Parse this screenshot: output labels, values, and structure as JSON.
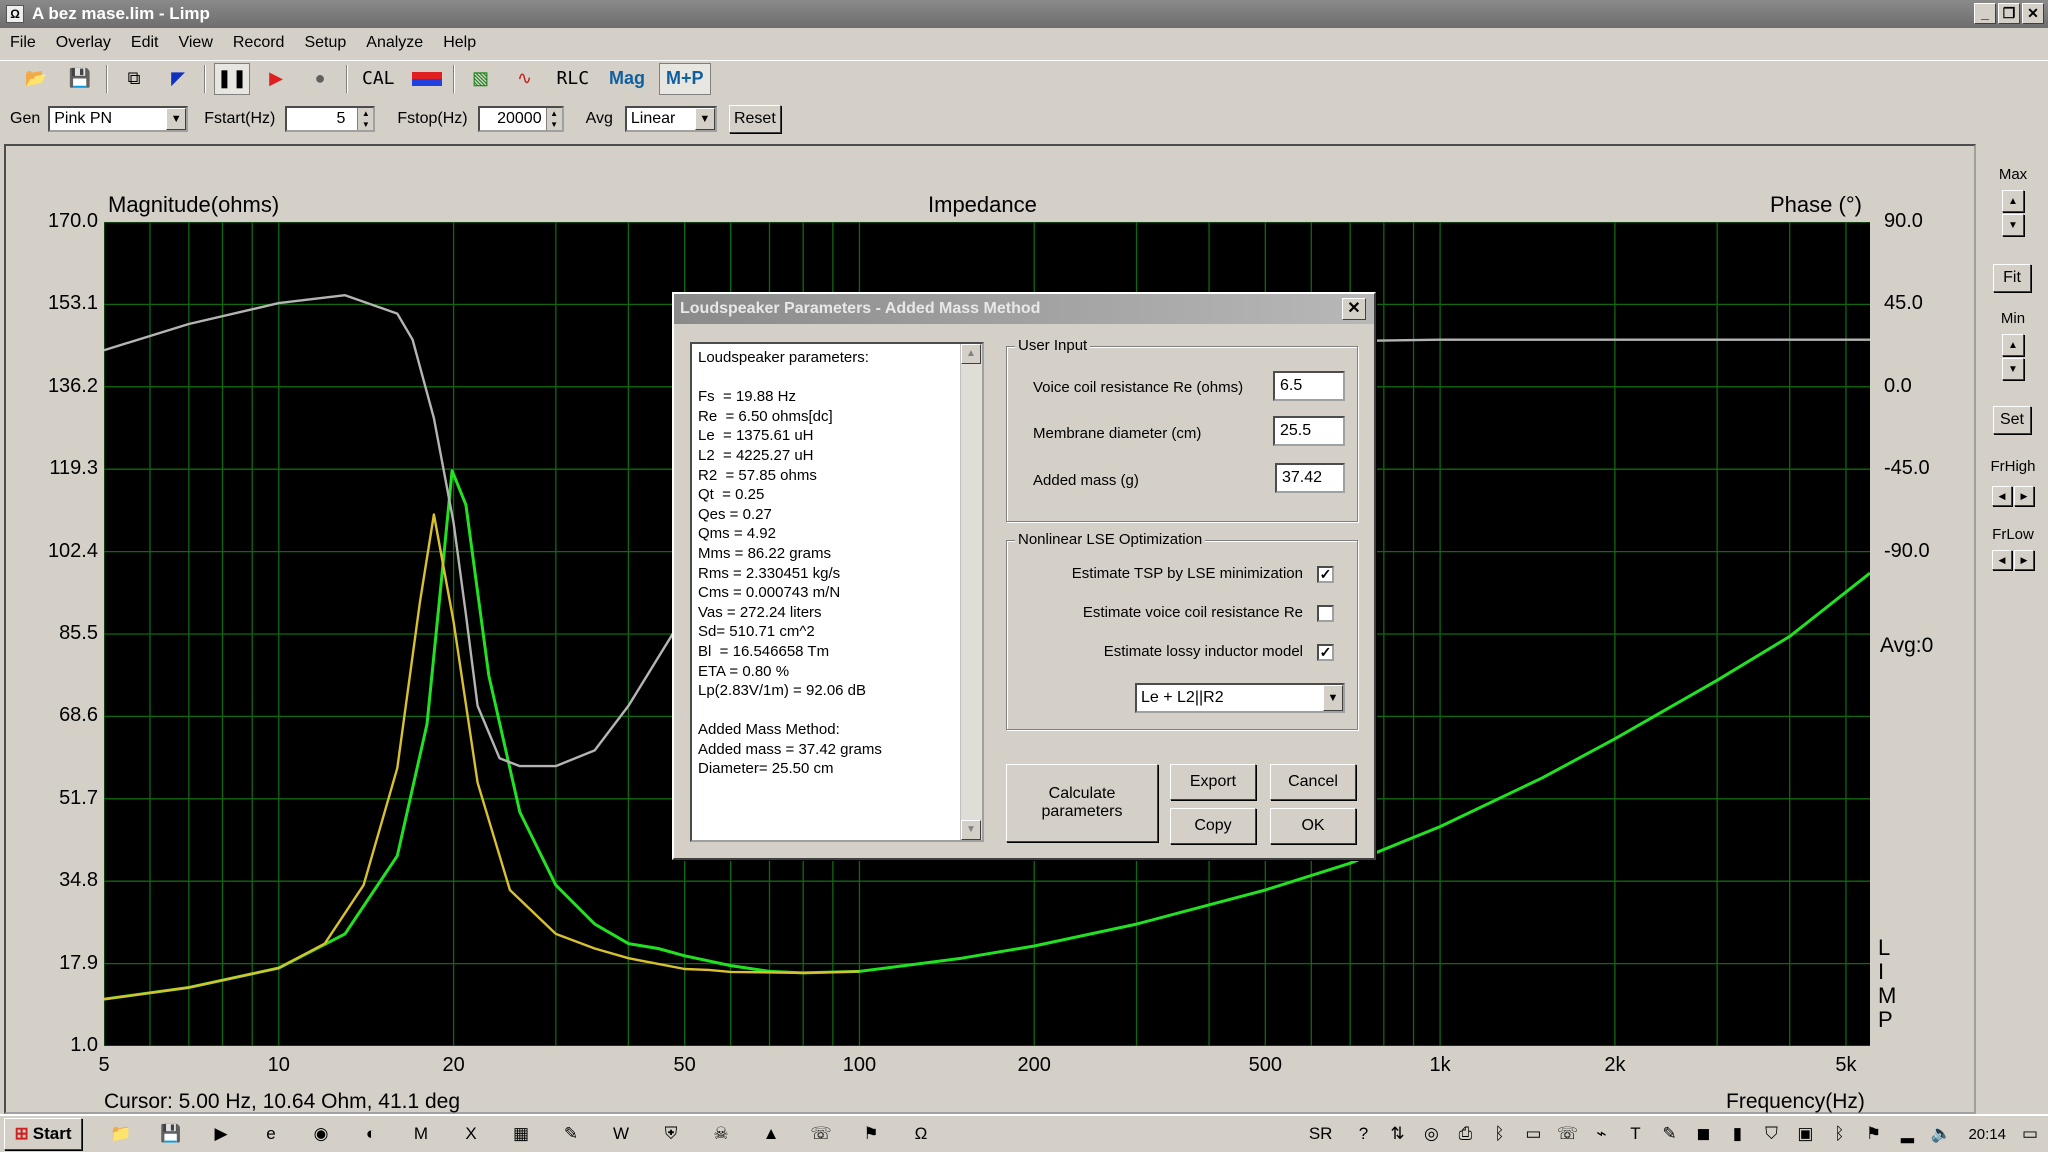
{
  "window": {
    "title": "A bez mase.lim - Limp",
    "app_icon": "window-icon"
  },
  "menu": [
    "File",
    "Overlay",
    "Edit",
    "View",
    "Record",
    "Setup",
    "Analyze",
    "Help"
  ],
  "toolbar": {
    "cal_label": "CAL",
    "rlc_label": "RLC",
    "mag_label": "Mag",
    "mp_label": "M+P",
    "icons": [
      "open-folder-icon",
      "save-disk-icon",
      "copy-icon",
      "pen-icon",
      "pause-icon",
      "play-icon",
      "stop-icon",
      "cal-icon",
      "color-bar-icon",
      "waveform-icon",
      "curve-icon",
      "rlc-icon",
      "mag-icon",
      "mp-icon"
    ]
  },
  "gen": {
    "gen_label": "Gen",
    "gen_value": "Pink PN",
    "fstart_label": "Fstart(Hz)",
    "fstart_value": "5",
    "fstop_label": "Fstop(Hz)",
    "fstop_value": "20000",
    "avg_label": "Avg",
    "avg_value": "Linear",
    "reset_label": "Reset"
  },
  "plot": {
    "title": "Impedance",
    "left_axis_title": "Magnitude(ohms)",
    "right_axis_title": "Phase (°)",
    "freq_label": "Frequency(Hz)",
    "avg_label": "Avg:0",
    "cursor": "Cursor: 5.00 Hz, 10.64 Ohm, 41.1 deg",
    "vertical_text": [
      "L",
      "I",
      "M",
      "P"
    ],
    "y_ticks": [
      "170.0",
      "153.1",
      "136.2",
      "119.3",
      "102.4",
      "85.5",
      "68.6",
      "51.7",
      "34.8",
      "17.9",
      "1.0"
    ],
    "phase_ticks": [
      "90.0",
      "45.0",
      "0.0",
      "-45.0",
      "-90.0"
    ],
    "x_ticks": [
      "5",
      "10",
      "20",
      "50",
      "100",
      "200",
      "500",
      "1k",
      "2k",
      "5k"
    ]
  },
  "chart_data": {
    "type": "line",
    "title": "Impedance",
    "xlabel": "Frequency(Hz)",
    "ylabel": "Magnitude(ohms)",
    "y2label": "Phase (°)",
    "xscale": "log",
    "xlim": [
      5,
      5500
    ],
    "ylim": [
      1.0,
      170.0
    ],
    "y2lim": [
      -225,
      90
    ],
    "grid": true,
    "series": [
      {
        "color": "#22e022",
        "axis": "magnitude",
        "x": [
          5,
          7,
          10,
          13,
          16,
          18,
          19,
          19.88,
          21,
          23,
          26,
          30,
          35,
          40,
          45,
          50,
          60,
          70,
          80,
          100,
          150,
          200,
          300,
          500,
          700,
          1000,
          1500,
          2000,
          3000,
          4000,
          5500
        ],
        "y": [
          10.6,
          13,
          17,
          24,
          40,
          67,
          95,
          119,
          112,
          77,
          49,
          34,
          26,
          22,
          21,
          19.5,
          17.5,
          16.3,
          16.0,
          16.3,
          19,
          21.5,
          26,
          33,
          38.5,
          46,
          56,
          64,
          76,
          85,
          98
        ]
      },
      {
        "color": "#d8c030",
        "axis": "magnitude",
        "x": [
          5,
          7,
          10,
          12,
          14,
          16,
          17.5,
          18.5,
          20,
          22,
          25,
          30,
          35,
          40,
          50,
          55,
          60,
          80,
          100
        ],
        "y": [
          10.6,
          13,
          17,
          22,
          34,
          58,
          92,
          110,
          88,
          55,
          33,
          24,
          21,
          19,
          16.8,
          16.6,
          16.2,
          16.0,
          16.3
        ]
      },
      {
        "color": "#b4b4b4",
        "axis": "phase",
        "x": [
          5,
          7,
          10,
          13,
          16,
          17,
          18.5,
          20,
          21,
          22,
          24,
          26,
          30,
          35,
          40,
          50,
          60,
          80,
          100,
          200,
          500,
          1000,
          2000,
          5500
        ],
        "y": [
          41,
          51,
          59,
          62,
          55,
          45,
          15,
          -25,
          -60,
          -95,
          -115,
          -118,
          -118,
          -112,
          -95,
          -60,
          -30,
          5,
          25,
          40,
          44,
          45,
          45,
          45
        ]
      }
    ]
  },
  "right_panel": {
    "max_label": "Max",
    "fit_label": "Fit",
    "min_label": "Min",
    "set_label": "Set",
    "frhigh_label": "FrHigh",
    "frlow_label": "FrLow"
  },
  "dialog": {
    "title": "Loudspeaker Parameters - Added Mass Method",
    "params_lines": [
      "Loudspeaker parameters:",
      "",
      "Fs  = 19.88 Hz",
      "Re  = 6.50 ohms[dc]",
      "Le  = 1375.61 uH",
      "L2  = 4225.27 uH",
      "R2  = 57.85 ohms",
      "Qt  = 0.25",
      "Qes = 0.27",
      "Qms = 4.92",
      "Mms = 86.22 grams",
      "Rms = 2.330451 kg/s",
      "Cms = 0.000743 m/N",
      "Vas = 272.24 liters",
      "Sd= 510.71 cm^2",
      "Bl  = 16.546658 Tm",
      "ETA = 0.80 %",
      "Lp(2.83V/1m) = 92.06 dB",
      "",
      "Added Mass Method:",
      "Added mass = 37.42 grams",
      "Diameter= 25.50 cm"
    ],
    "user_input_title": "User Input",
    "re_label": "Voice coil resistance Re (ohms)",
    "re_value": "6.5",
    "diam_label": "Membrane diameter (cm)",
    "diam_value": "25.5",
    "mass_label": "Added mass (g)",
    "mass_value": "37.42",
    "lse_title": "Nonlinear LSE Optimization",
    "cb1_label": "Estimate TSP by LSE minimization",
    "cb1_checked": true,
    "cb2_label": "Estimate voice coil resistance Re",
    "cb2_checked": false,
    "cb3_label": "Estimate lossy inductor model",
    "cb3_checked": true,
    "model_value": "Le + L2||R2",
    "calc_label": "Calculate parameters",
    "export_label": "Export",
    "cancel_label": "Cancel",
    "copy_label": "Copy",
    "ok_label": "OK"
  },
  "taskbar": {
    "start_label": "Start",
    "lang": "SR",
    "clock": "20:14",
    "quick_icons": [
      "explorer-icon",
      "save-icon",
      "media-icon",
      "ie-icon",
      "chrome-icon",
      "edge-icon",
      "m-icon",
      "excel-icon",
      "calc-icon",
      "pen-icon",
      "word-icon",
      "network-icon",
      "skull-icon",
      "pdf-icon",
      "viber-icon",
      "flag-icon",
      "limp-icon"
    ],
    "tray_icons": [
      "help-icon",
      "arrow-icon",
      "avast-icon",
      "printer-icon",
      "bluetooth-icon",
      "monitor-icon",
      "viber-icon",
      "usb-icon",
      "text-icon",
      "pen-icon",
      "nvidia-icon",
      "battery-icon",
      "shield-icon",
      "screen-icon",
      "bluetooth-icon",
      "flag-icon",
      "signal-icon",
      "volume-icon"
    ]
  }
}
